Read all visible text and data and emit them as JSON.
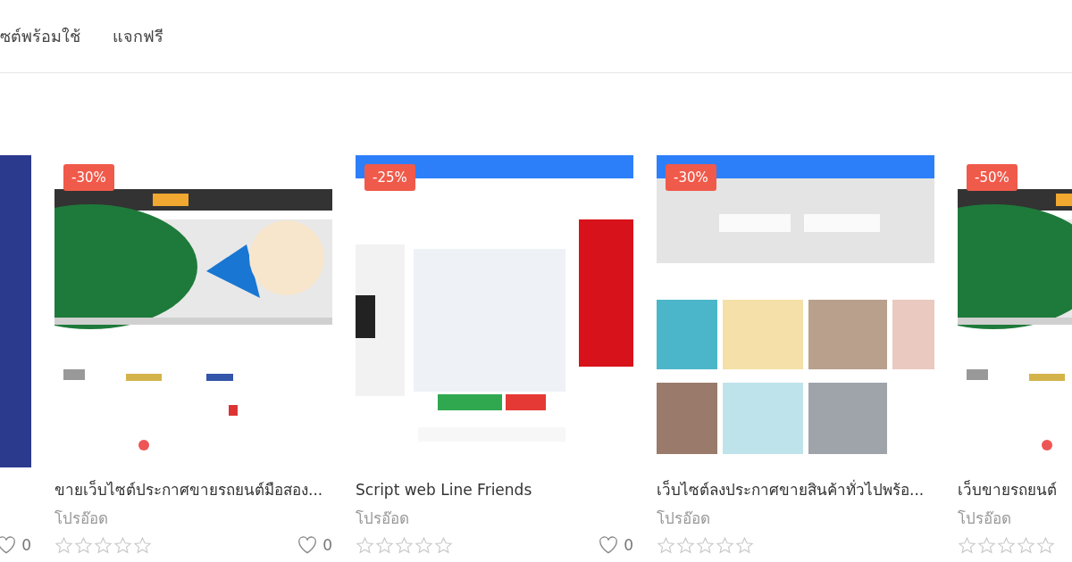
{
  "nav": {
    "items": [
      {
        "label": "ซต์พร้อมใช้"
      },
      {
        "label": "แจกฟรี"
      }
    ]
  },
  "products": [
    {
      "likes": "0"
    },
    {
      "discount": "-30%",
      "title": "ขายเว็บไซต์ประกาศขายรถยนต์มือสอง...",
      "seller": "โปรอ๊อด",
      "stars": 0,
      "likes": "0"
    },
    {
      "discount": "-25%",
      "title": "Script web Line Friends",
      "seller": "โปรอ๊อด",
      "stars": 0,
      "likes": "0"
    },
    {
      "discount": "-30%",
      "title": "เว็บไซต์ลงประกาศขายสินค้าทั่วไปพร้อ...",
      "seller": "โปรอ๊อด",
      "stars": 0
    },
    {
      "discount": "-50%",
      "title": "เว็บขายรถยนต์",
      "seller": "โปรอ๊อด",
      "stars": 0
    }
  ]
}
